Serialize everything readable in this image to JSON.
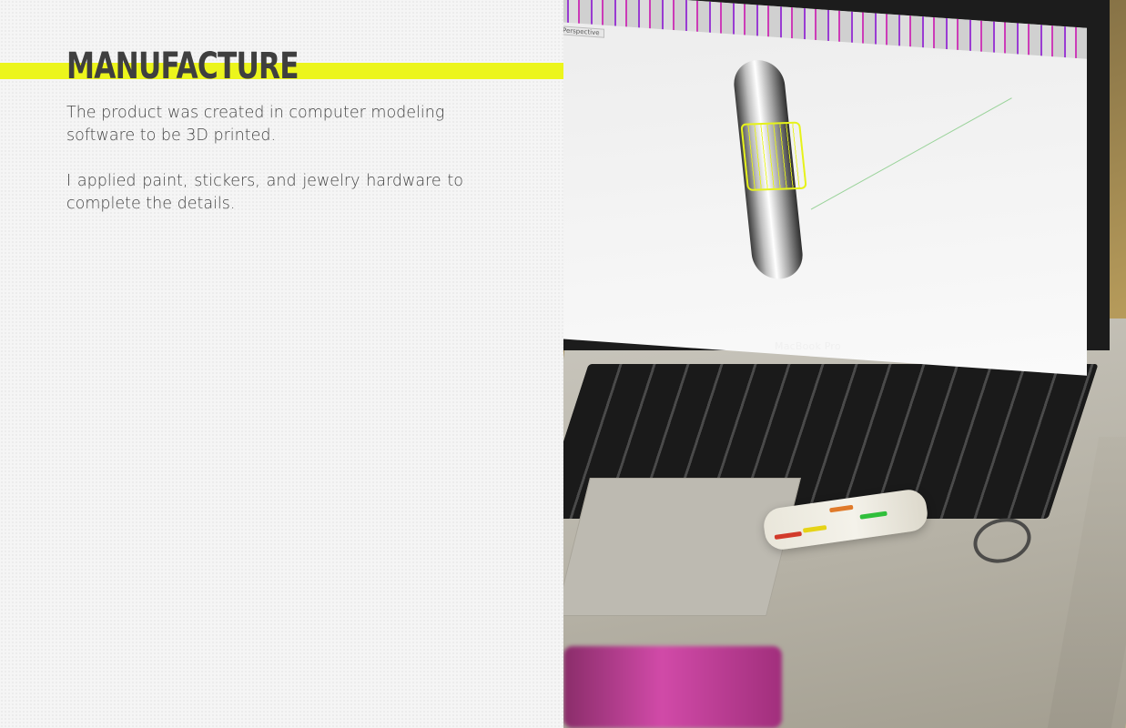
{
  "page": {
    "title": "MANUFACTURE",
    "paragraphs": [
      "The product was created in computer modeling software to be 3D printed.",
      "I applied paint, stickers, and jewelry hardware to complete the details."
    ]
  },
  "photo": {
    "screen_viewport_label": "Perspective",
    "laptop_brand": "MacBook Pro"
  },
  "colors": {
    "accent": "#ecf51c",
    "heading": "#3f3f3f",
    "body_text": "#454545",
    "background": "#f5f5f5"
  }
}
